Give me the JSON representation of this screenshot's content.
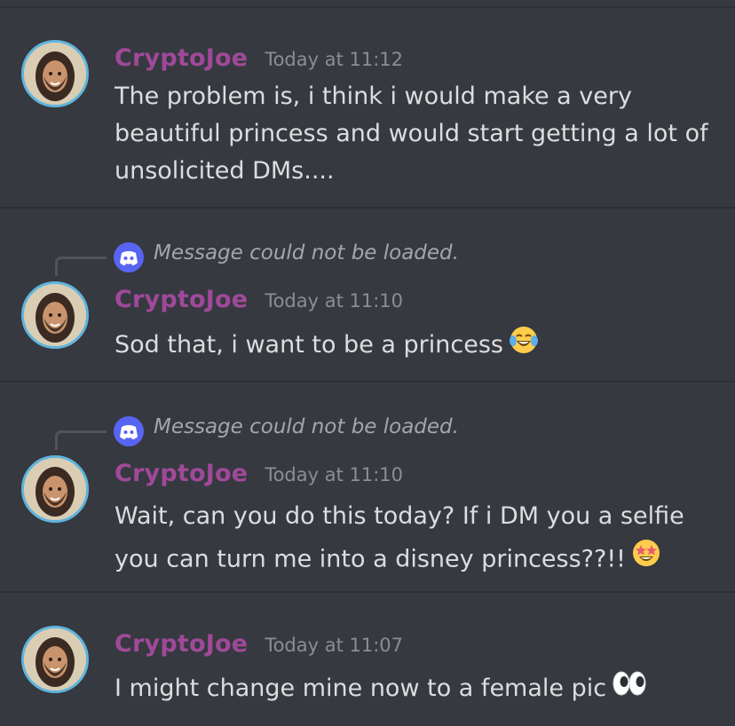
{
  "messages": [
    {
      "username": "CryptoJoe",
      "timestamp": "Today at 11:12",
      "text": "The problem is, i think i would make a very beautiful princess and would start getting a lot of unsolicited DMs....",
      "reply": null,
      "emoji": null
    },
    {
      "username": "CryptoJoe",
      "timestamp": "Today at 11:10",
      "text": "Sod that, i want to be a princess",
      "reply": "Message could not be loaded.",
      "emoji": "tears-of-joy"
    },
    {
      "username": "CryptoJoe",
      "timestamp": "Today at 11:10",
      "text": "Wait, can you do this today? If i DM you a selfie you can turn me into a disney princess??!!",
      "reply": "Message could not be loaded.",
      "emoji": "star-struck"
    },
    {
      "username": "CryptoJoe",
      "timestamp": "Today at 11:07",
      "text": "I might change mine now to a female pic",
      "reply": null,
      "emoji": "eyes"
    }
  ],
  "colors": {
    "background": "#36393f",
    "username": "#a0499a",
    "message_text": "#dcddde",
    "timestamp": "#8a8e95",
    "avatar_ring": "#5fb4de",
    "reply_icon": "#5865f2"
  }
}
